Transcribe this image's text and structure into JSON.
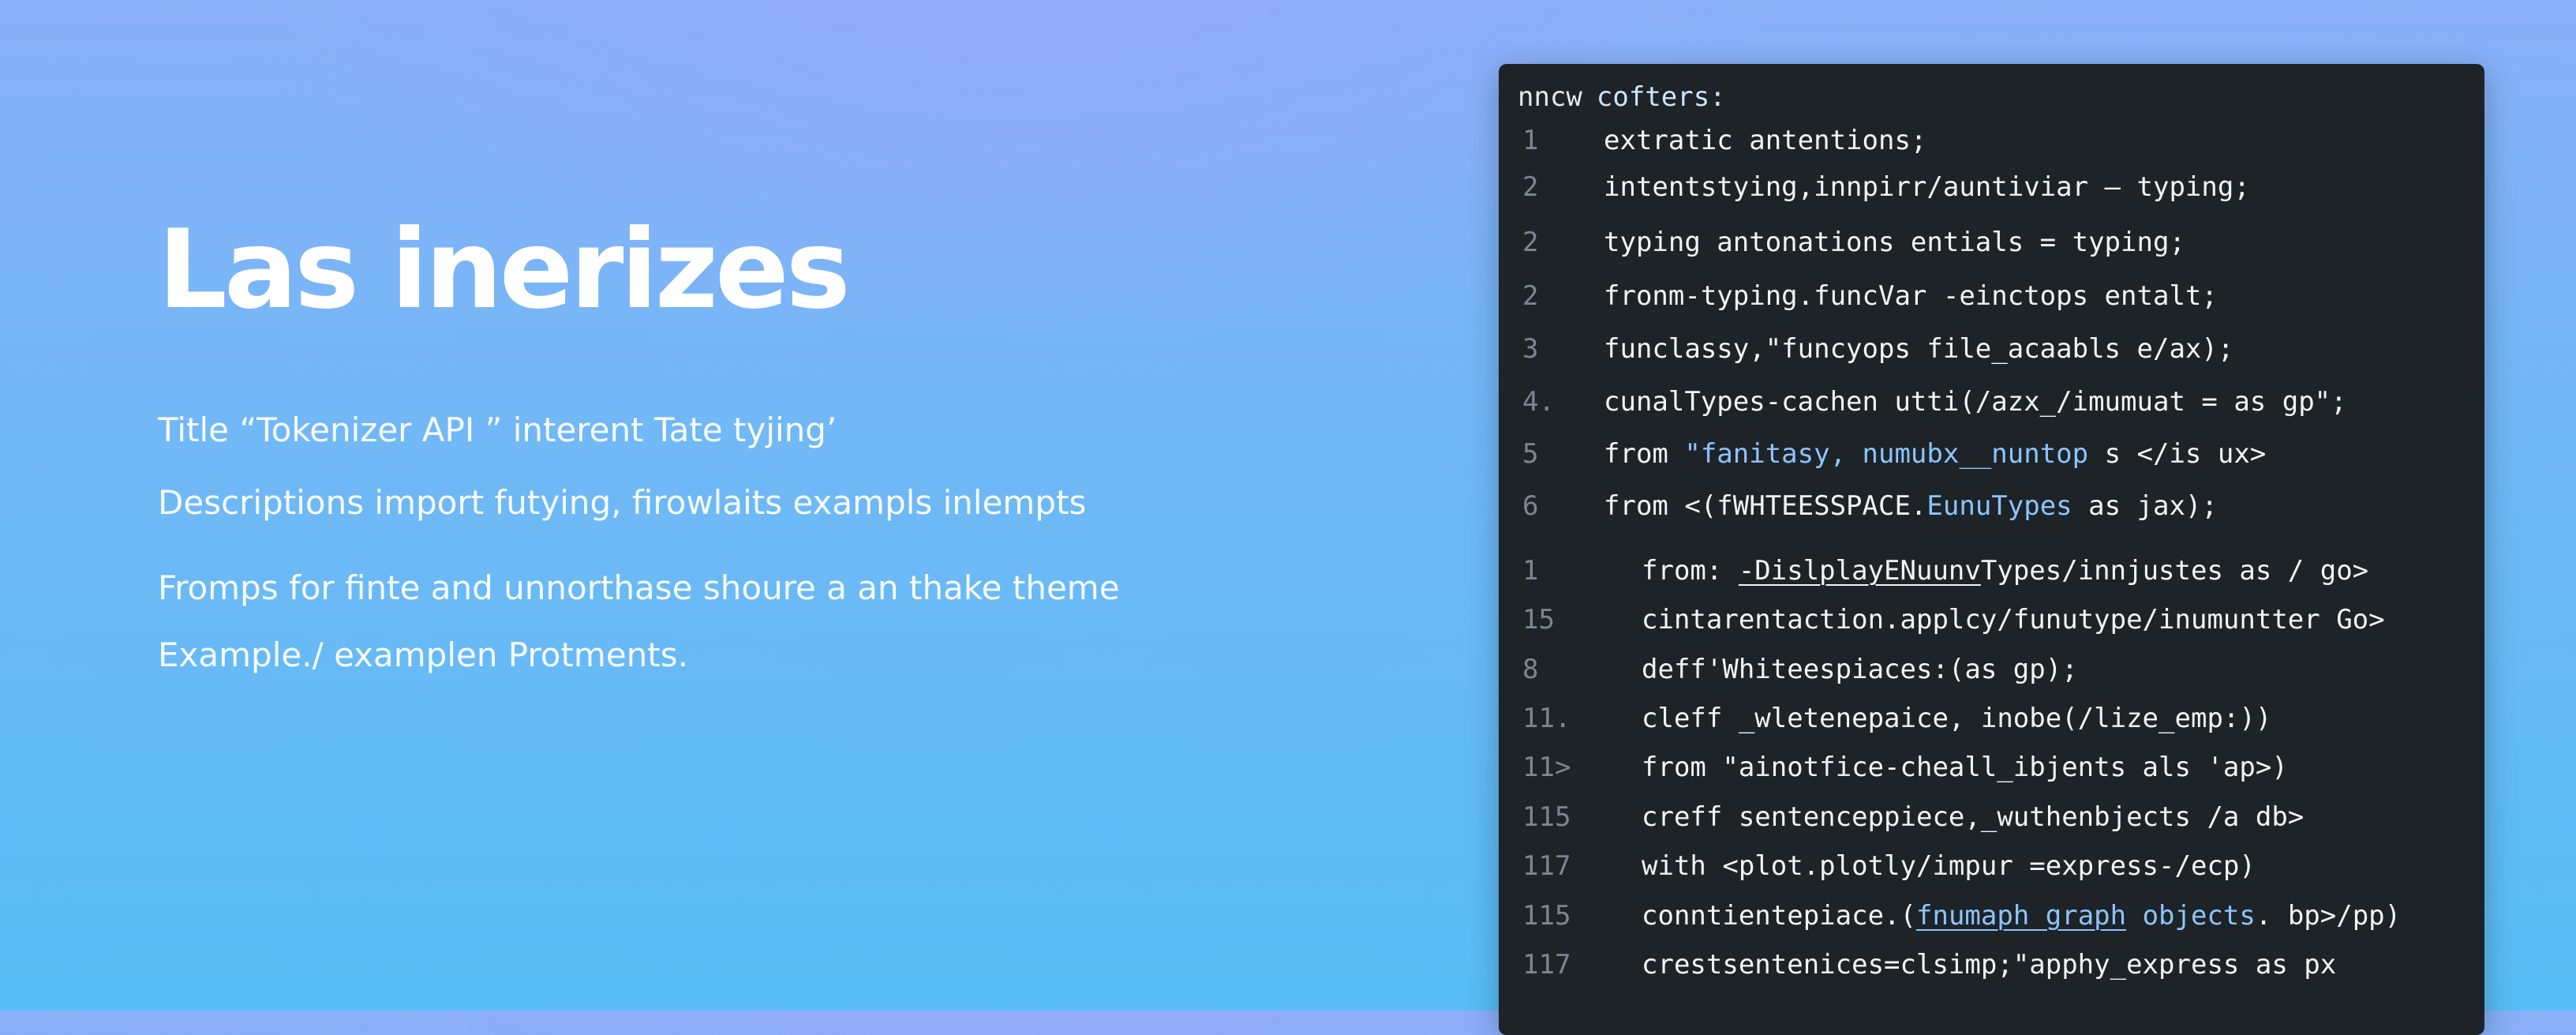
{
  "hero": {
    "title": "Las inerizes",
    "lines": [
      "Title “Tokenizer API ” interent Tate tyjing’",
      "Descriptions import futying, firowlaits exampls inlempts",
      "Fromps for finte and unnorthase shoure a an thake theme",
      "Example./ examplen Protments."
    ]
  },
  "editor": {
    "header_left": "nncw",
    "header_right": "cofters:",
    "lines": [
      {
        "num": "1",
        "pre": "extratic antentions;",
        "hl": "",
        "post": ""
      },
      {
        "num": "2",
        "pre": "intentstying,innpirr/auntiviar — typing;",
        "hl": "",
        "post": ""
      },
      {
        "num": "2",
        "pre": "typing antonations entials = typing;",
        "hl": "",
        "post": ""
      },
      {
        "num": "2",
        "pre": "fronm-typing.funcVar -einctops entalt;",
        "hl": "",
        "post": ""
      },
      {
        "num": "3",
        "pre": "funclassy,\"funcyops  file_acaabls e/ax);",
        "hl": "",
        "post": ""
      },
      {
        "num": "4.",
        "pre": "cunalTypes-cachen utti(/azx_/imumuat = as gp\";",
        "hl": "",
        "post": ""
      },
      {
        "num": "5",
        "pre": "from ",
        "hl": "\"fanitasy, numubx__nuntop",
        "post": " s </is ux>"
      },
      {
        "num": "6",
        "pre": "from <(fWHTEESSPACE.",
        "hl": "EunuTypes",
        "post": " as jax);"
      },
      {
        "num": "1",
        "pre": "from: ",
        "hl": "",
        "ul": "-DislplayENuunv",
        "post": "Types/innjustes as / go>"
      },
      {
        "num": "15",
        "pre": "cintarentaction.applcy/funutype/inumuntter Go>",
        "hl": "",
        "post": ""
      },
      {
        "num": "8",
        "pre": "deff'Whiteespiaces:(as gp);",
        "hl": "",
        "post": ""
      },
      {
        "num": "11.",
        "pre": "cleff _wletenepaice, inobe(/lize_emp:))",
        "hl": "",
        "post": ""
      },
      {
        "num": "11>",
        "pre": "from \"ainotfice-cheall_ibjents als 'ap>)",
        "hl": "",
        "post": ""
      },
      {
        "num": "115",
        "pre": "creff sentenceppiece,_wuthenbjects /a db>",
        "hl": "",
        "post": ""
      },
      {
        "num": "117",
        "pre": "with <plot.plotly/impur =express-/ecp)",
        "hl": "",
        "post": ""
      },
      {
        "num": "115",
        "pre": "conntientepiace.(",
        "hl": "",
        "ulhl": "fnumaph graph",
        "hl2": " objects",
        "post": ". bp>/pp)"
      },
      {
        "num": "117",
        "pre": "crestsentenices=clsimp;\"apphy_express as px",
        "hl": "",
        "post": ""
      }
    ]
  },
  "colors": {
    "editor_bg": "#1e2327",
    "code_text": "#f1f3f5",
    "line_number": "#7b8593",
    "highlight": "#8cc4ff"
  }
}
